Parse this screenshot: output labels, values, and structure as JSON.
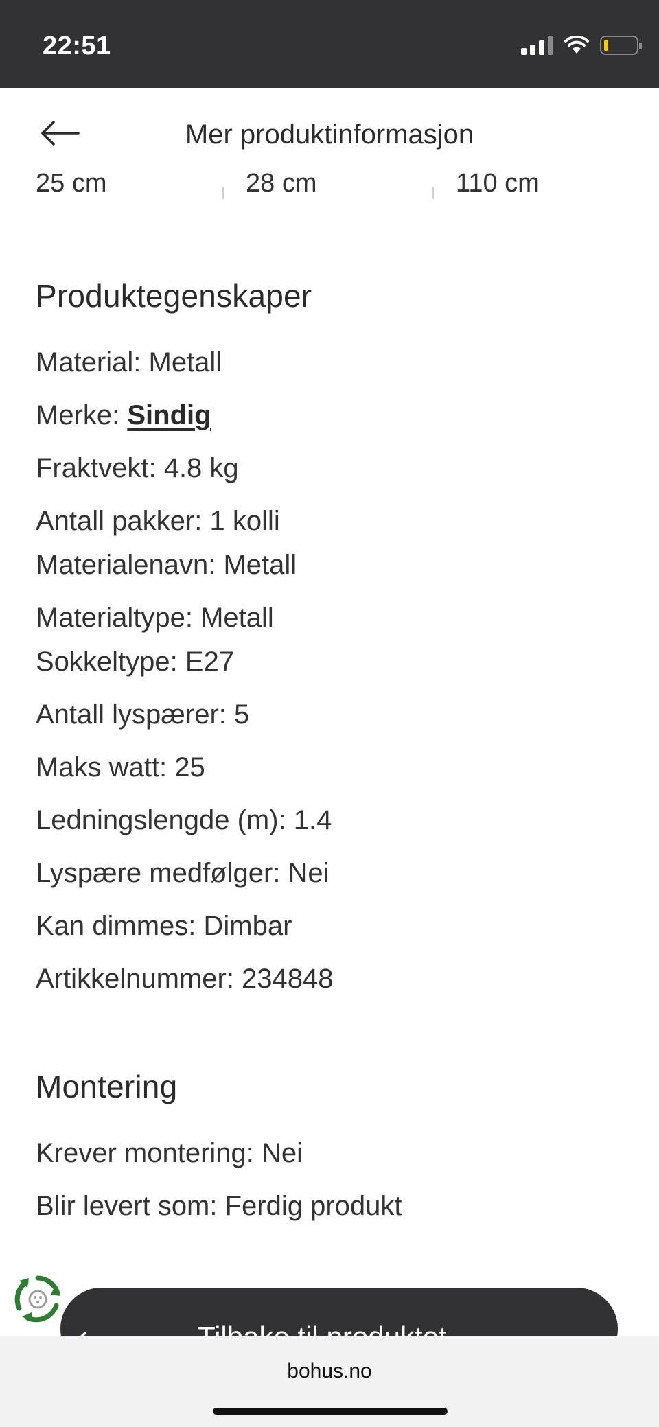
{
  "status_bar": {
    "time": "22:51",
    "icons": [
      "signal-icon",
      "wifi-icon",
      "battery-icon"
    ]
  },
  "header": {
    "title": "Mer produktinformasjon",
    "back_icon": "arrow-left-icon"
  },
  "dimensions": [
    "25 cm",
    "28 cm",
    "110 cm"
  ],
  "properties_section": {
    "title": "Produktegenskaper",
    "items": [
      "Material: Metall",
      {
        "label": "Merke: ",
        "link": "Sindig"
      },
      "Fraktvekt: 4.8 kg",
      "Antall pakker: 1 kolli",
      "Materialenavn: Metall",
      "Materialtype: Metall",
      "Sokkeltype: E27",
      "Antall lyspærer: 5",
      "Maks watt: 25",
      "Ledningslengde (m): 1.4",
      "Lyspære medfølger: Nei",
      "Kan dimmes: Dimbar",
      "Artikkelnummer: 234848"
    ]
  },
  "assembly_section": {
    "title": "Montering",
    "items": [
      "Krever montering: Nei",
      "Blir levert som: Ferdig produkt"
    ]
  },
  "bottom_button": {
    "label": "Tilbake til produktet",
    "icon": "arrow-left-icon"
  },
  "badge_icon": "recycle-icon",
  "colors": {
    "dark": "#323234",
    "text": "#2b2b2b",
    "accent_green": "#2e7d32"
  },
  "browser": {
    "url": "bohus.no"
  }
}
